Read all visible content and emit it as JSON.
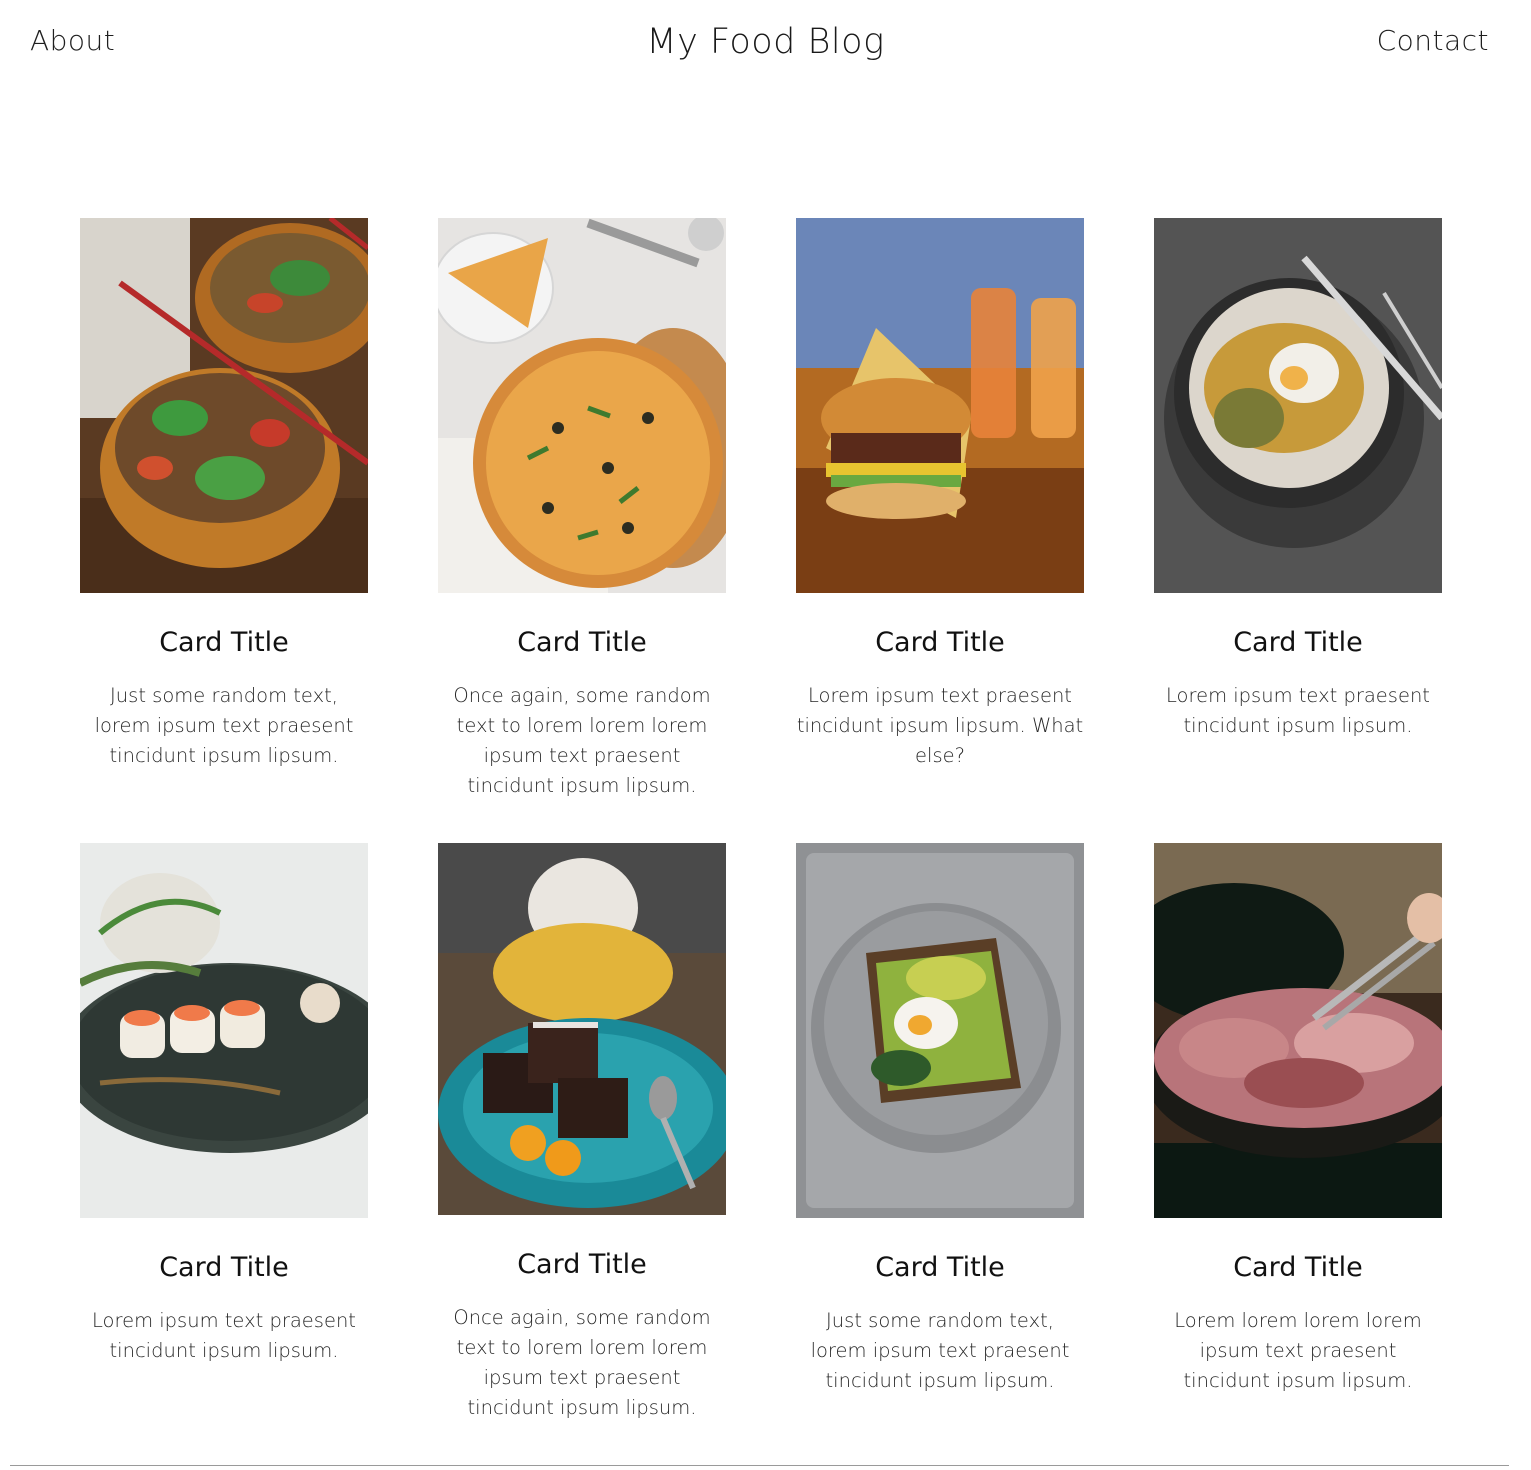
{
  "header": {
    "about_label": "About",
    "title": "My Food Blog",
    "contact_label": "Contact"
  },
  "cards": [
    {
      "title": "Card Title",
      "text": "Just some random text, lorem ipsum text praesent tincidunt ipsum lipsum.",
      "image": "noodle-bowls-image"
    },
    {
      "title": "Card Title",
      "text": "Once again, some random text to lorem lorem lorem ipsum text praesent tincidunt ipsum lipsum.",
      "image": "pizza-image"
    },
    {
      "title": "Card Title",
      "text": "Lorem ipsum text praesent tincidunt ipsum lipsum. What else?",
      "image": "burger-image"
    },
    {
      "title": "Card Title",
      "text": "Lorem ipsum text praesent tincidunt ipsum lipsum.",
      "image": "egg-plate-image"
    },
    {
      "title": "Card Title",
      "text": "Lorem ipsum text praesent tincidunt ipsum lipsum.",
      "image": "sushi-image"
    },
    {
      "title": "Card Title",
      "text": "Once again, some random text to lorem lorem lorem ipsum text praesent tincidunt ipsum lipsum.",
      "image": "brownie-image"
    },
    {
      "title": "Card Title",
      "text": "Just some random text, lorem ipsum text praesent tincidunt ipsum lipsum.",
      "image": "avocado-toast-image"
    },
    {
      "title": "Card Title",
      "text": "Lorem lorem lorem lorem ipsum text praesent tincidunt ipsum lipsum.",
      "image": "grill-meat-image"
    }
  ]
}
